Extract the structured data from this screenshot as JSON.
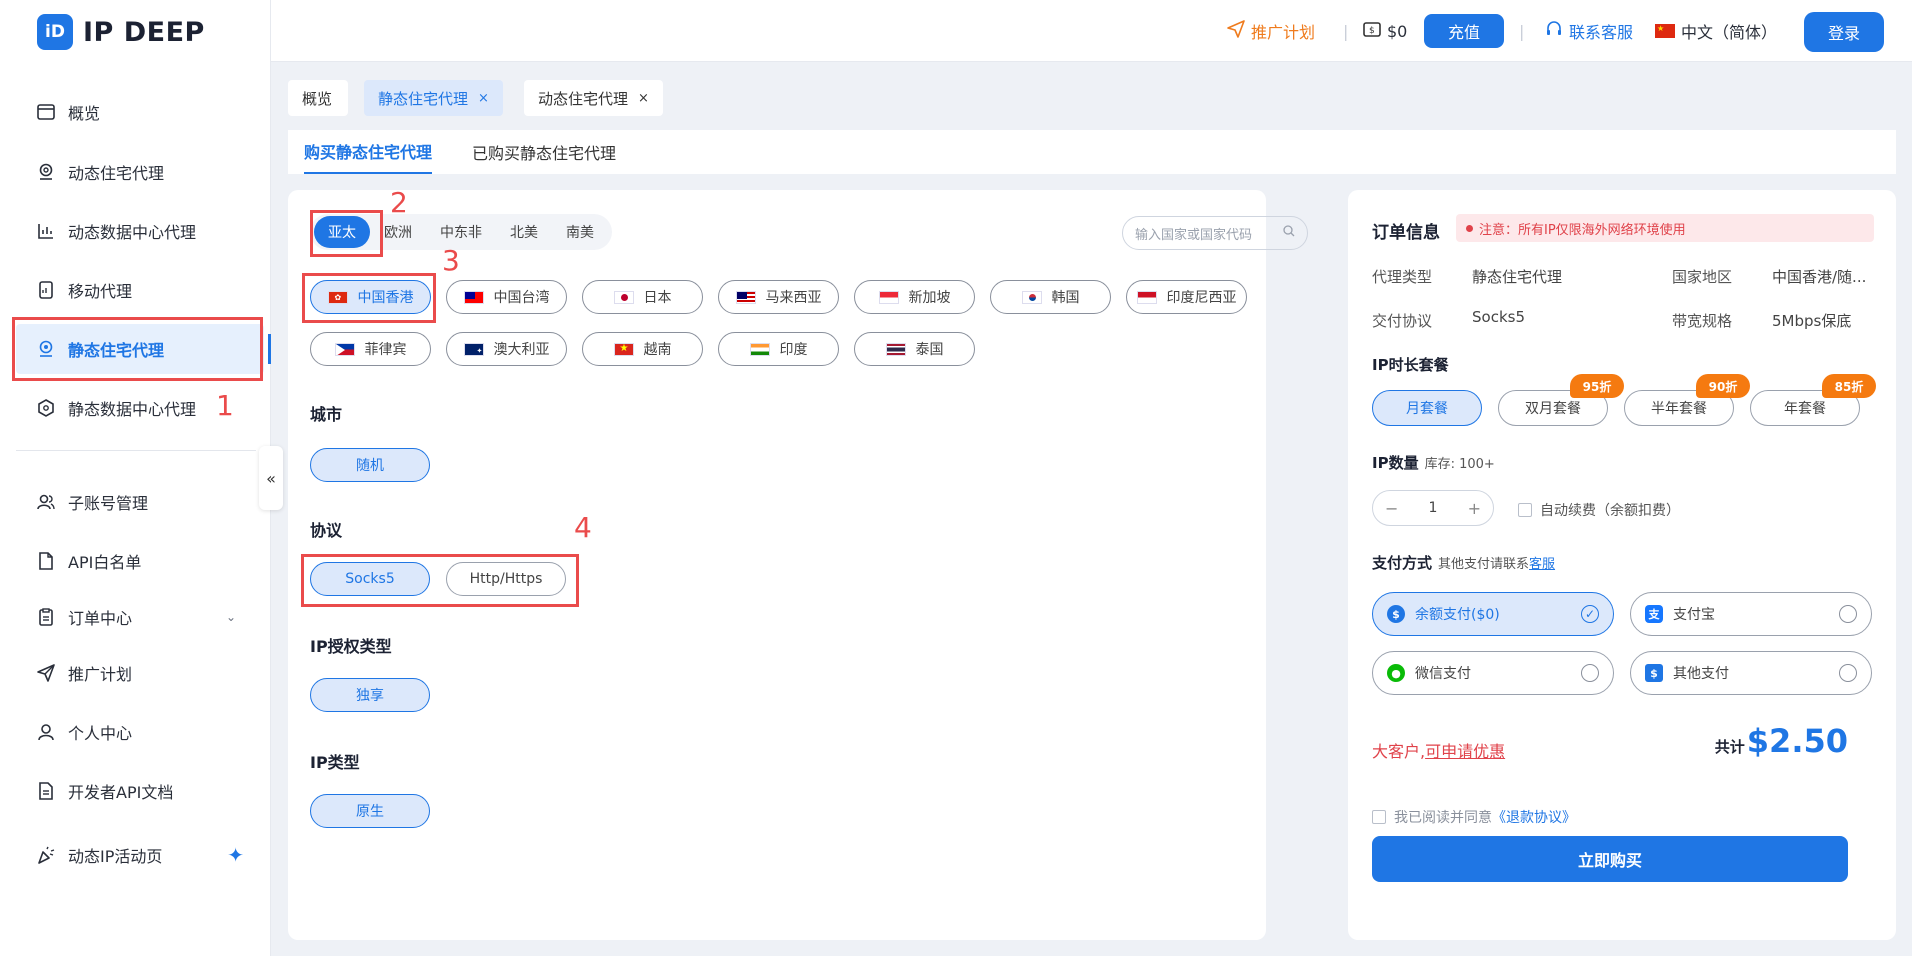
{
  "brand": {
    "logo_mark": "iD",
    "name": "IP DEEP"
  },
  "sidebar": {
    "items": [
      {
        "label": "概览",
        "icon": "card-icon"
      },
      {
        "label": "动态住宅代理",
        "icon": "location-icon"
      },
      {
        "label": "动态数据中心代理",
        "icon": "chart-icon"
      },
      {
        "label": "移动代理",
        "icon": "mobile-icon"
      },
      {
        "label": "静态住宅代理",
        "icon": "pin-icon",
        "active": true
      },
      {
        "label": "静态数据中心代理",
        "icon": "hexagon-icon"
      },
      {
        "label": "子账号管理",
        "icon": "users-icon"
      },
      {
        "label": "API白名单",
        "icon": "doc-icon"
      },
      {
        "label": "订单中心",
        "icon": "clipboard-icon"
      },
      {
        "label": "推广计划",
        "icon": "send-icon"
      },
      {
        "label": "个人中心",
        "icon": "user-icon"
      },
      {
        "label": "开发者API文档",
        "icon": "file-icon"
      },
      {
        "label": "动态IP活动页",
        "icon": "party-icon"
      }
    ],
    "collapse": "«"
  },
  "annotations": {
    "n1": "1",
    "n2": "2",
    "n3": "3",
    "n4": "4"
  },
  "topbar": {
    "promo": "推广计划",
    "balance": "$0",
    "recharge": "充值",
    "support": "联系客服",
    "language": "中文（简体）",
    "login": "登录"
  },
  "page_tabs": [
    {
      "label": "概览"
    },
    {
      "label": "静态住宅代理",
      "close": "×",
      "active": true
    },
    {
      "label": "动态住宅代理",
      "close": "×"
    }
  ],
  "sub_tabs": {
    "buy": "购买静态住宅代理",
    "bought": "已购买静态住宅代理"
  },
  "regions": [
    "亚太",
    "欧洲",
    "中东非",
    "北美",
    "南美"
  ],
  "search": {
    "placeholder": "输入国家或国家代码"
  },
  "countries": [
    "中国香港",
    "中国台湾",
    "日本",
    "马来西亚",
    "新加坡",
    "韩国",
    "印度尼西亚",
    "菲律宾",
    "澳大利亚",
    "越南",
    "印度",
    "泰国"
  ],
  "sections": {
    "city": {
      "label": "城市",
      "options": [
        "随机"
      ]
    },
    "protocol": {
      "label": "协议",
      "options": [
        "Socks5",
        "Http/Https"
      ]
    },
    "auth": {
      "label": "IP授权类型",
      "options": [
        "独享"
      ]
    },
    "iptype": {
      "label": "IP类型",
      "options": [
        "原生"
      ]
    }
  },
  "order": {
    "title": "订单信息",
    "notice": "注意：所有IP仅限海外网络环境使用",
    "proxy_type_label": "代理类型",
    "proxy_type": "静态住宅代理",
    "region_label": "国家地区",
    "region": "中国香港/随...",
    "protocol_label": "交付协议",
    "protocol": "Socks5",
    "bandwidth_label": "带宽规格",
    "bandwidth": "5Mbps保底",
    "plan_label": "IP时长套餐",
    "plans": [
      "月套餐",
      "双月套餐",
      "半年套餐",
      "年套餐"
    ],
    "discounts": [
      "95折",
      "90折",
      "85折"
    ],
    "qty_label": "IP数量",
    "stock": "库存: 100+",
    "qty": "1",
    "minus": "−",
    "plus": "+",
    "auto_renew": "自动续费（余额扣费）",
    "pay_label": "支付方式",
    "pay_sub": "其他支付请联系",
    "pay_link": "客服",
    "pay_methods": [
      "余额支付($0)",
      "支付宝",
      "微信支付",
      "其他支付"
    ],
    "big_client": "大客户,",
    "big_client_link": "可申请优惠",
    "total_label": "共计",
    "total": "$2.50",
    "agree": "我已阅读并同意",
    "agree_link": "《退款协议》",
    "buy": "立即购买"
  }
}
